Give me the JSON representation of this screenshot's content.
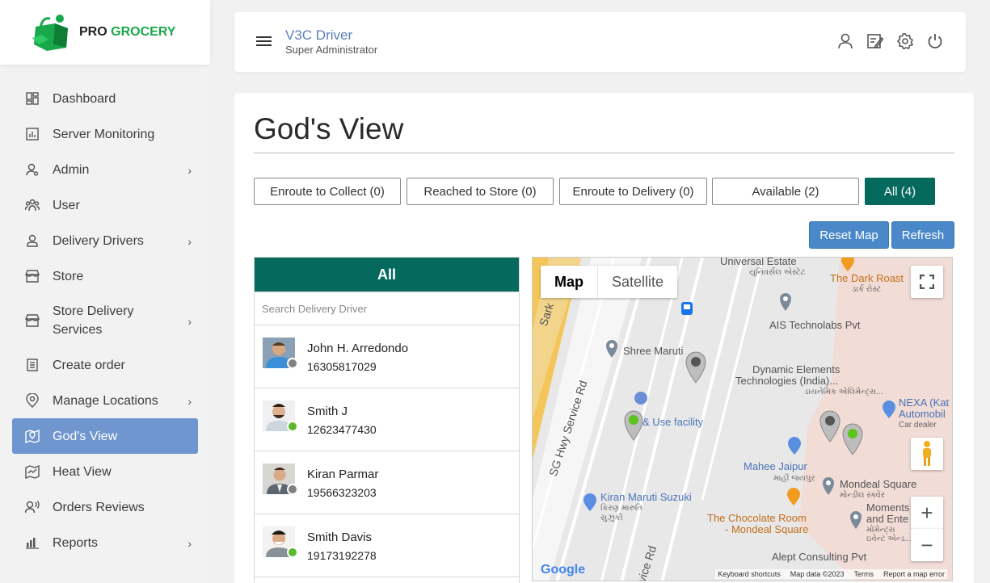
{
  "brand": {
    "pro": "PRO",
    "grocery": "GROCERY"
  },
  "sidebar": {
    "items": [
      {
        "label": "Dashboard"
      },
      {
        "label": "Server Monitoring"
      },
      {
        "label": "Admin"
      },
      {
        "label": "User"
      },
      {
        "label": "Delivery Drivers"
      },
      {
        "label": "Store"
      },
      {
        "label": "Store Delivery Services"
      },
      {
        "label": "Create order"
      },
      {
        "label": "Manage Locations"
      },
      {
        "label": "God's View"
      },
      {
        "label": "Heat View"
      },
      {
        "label": "Orders Reviews"
      },
      {
        "label": "Reports"
      }
    ]
  },
  "header": {
    "user_name": "V3C Driver",
    "user_role": "Super Administrator"
  },
  "page": {
    "title": "God's View"
  },
  "filters": [
    {
      "label": "Enroute to Collect  (0)"
    },
    {
      "label": "Reached to Store  (0)"
    },
    {
      "label": "Enroute to Delivery  (0)"
    },
    {
      "label": "Available  (2)"
    },
    {
      "label": "All  (4)"
    }
  ],
  "actions": {
    "reset_map": "Reset Map",
    "refresh": "Refresh"
  },
  "driver_list": {
    "heading": "All",
    "search_placeholder": "Search Delivery Driver",
    "drivers": [
      {
        "name": "John H. Arredondo",
        "phone": "16305817029",
        "status_color": "#808080"
      },
      {
        "name": "Smith J",
        "phone": "12623477430",
        "status_color": "#5cb82c"
      },
      {
        "name": "Kiran Parmar",
        "phone": "19566323203",
        "status_color": "#808080"
      },
      {
        "name": "Smith Davis",
        "phone": "19173192278",
        "status_color": "#5cb82c"
      }
    ]
  },
  "map": {
    "toggle_map": "Map",
    "toggle_satellite": "Satellite",
    "labels": {
      "universal": "Universal Estate",
      "universal_gu": "યુનિવર્સલ એસ્ટેટ",
      "dark_roast": "The Dark Roast",
      "dark_roast_gu": "ડાર્ક રોસ્ટ",
      "ais": "AIS Technolabs Pvt",
      "shree": "Shree Maruti",
      "dynamic1": "Dynamic Elements",
      "dynamic2": "Technologies (India)...",
      "dynamic_gu": "ડાયનેમિક એલિમેન્ટ્સ...",
      "nexa1": "NEXA (Kat",
      "nexa2": "Automobil",
      "car_dealer": "Car dealer",
      "use_facility": "& Use facility",
      "mahee": "Mahee Jaipur",
      "mahee_gu": "માહી જયપુર",
      "mondeal": "Mondeal Square",
      "mondeal_gu": "મોન્ડીલ સ્ક્વેર",
      "kiran": "Kiran Maruti Suzuki",
      "kiran_gu": "કિરણ મારુતિ",
      "kiran_gu2": "સુઝુકી",
      "choc1": "The Chocolate Room",
      "choc2": "- Mondeal Square",
      "moments1": "Moments",
      "moments2": "and Ente",
      "moments_gu": "મોમેન્ટ્સ",
      "moments_gu2": "ઇવેન્ટ એન્ડ...",
      "alept": "Alept Consulting Pvt",
      "sg_road": "SG Hwy Service Rd",
      "service_rd": "rvice Rd",
      "sark": "Sark",
      "google": "Google",
      "footer_shortcuts": "Keyboard shortcuts",
      "footer_data": "Map data ©2023",
      "footer_terms": "Terms",
      "footer_report": "Report a map error"
    }
  }
}
